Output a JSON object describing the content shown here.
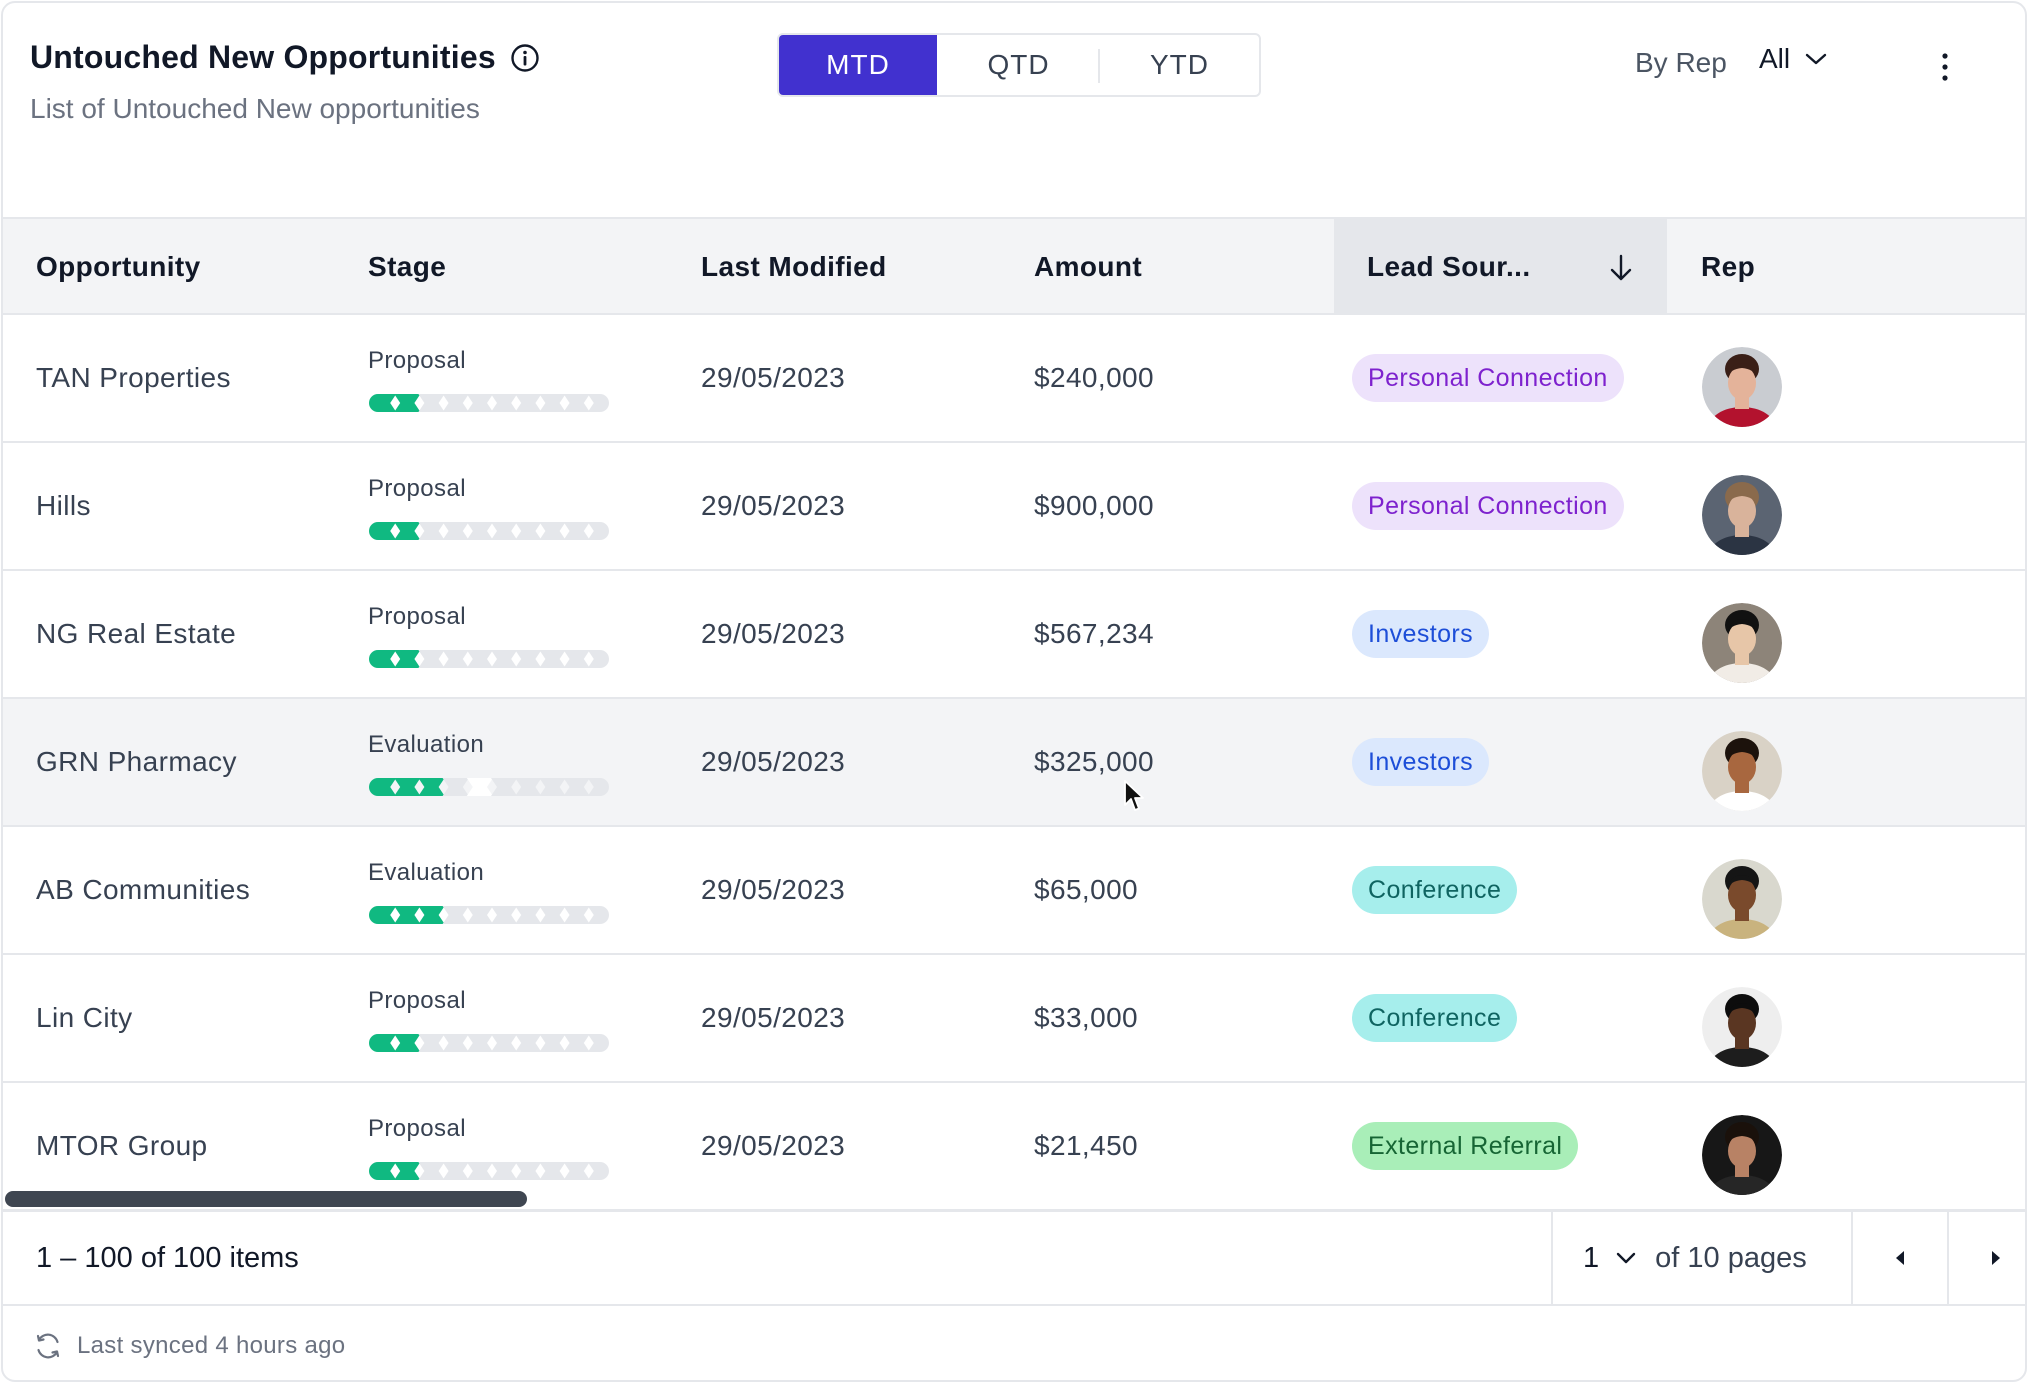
{
  "header": {
    "title": "Untouched New Opportunities",
    "subtitle": "List of Untouched New opportunities",
    "info_icon": "info-circle-icon"
  },
  "period_tabs": [
    {
      "label": "MTD",
      "active": true
    },
    {
      "label": "QTD",
      "active": false
    },
    {
      "label": "YTD",
      "active": false
    }
  ],
  "rep_filter": {
    "label": "By Rep",
    "value": "All",
    "icon": "chevron-down-icon"
  },
  "menu_icon": "kebab-menu-icon",
  "table": {
    "columns": [
      "Opportunity",
      "Stage",
      "Last Modified",
      "Amount",
      "Lead Sour...",
      "Rep"
    ],
    "sorted_column": "Lead Sour...",
    "sort_direction": "descending",
    "stage_segments_total": 10,
    "rows": [
      {
        "opportunity": "TAN Properties",
        "stage": "Proposal",
        "stage_progress": 2,
        "last_modified": "29/05/2023",
        "amount": "$240,000",
        "lead_source": "Personal Connection",
        "lead_color": "purple"
      },
      {
        "opportunity": "Hills",
        "stage": "Proposal",
        "stage_progress": 2,
        "last_modified": "29/05/2023",
        "amount": "$900,000",
        "lead_source": "Personal Connection",
        "lead_color": "purple"
      },
      {
        "opportunity": "NG Real Estate",
        "stage": "Proposal",
        "stage_progress": 2,
        "last_modified": "29/05/2023",
        "amount": "$567,234",
        "lead_source": "Investors",
        "lead_color": "blue"
      },
      {
        "opportunity": "GRN Pharmacy",
        "stage": "Evaluation",
        "stage_progress": 3,
        "last_modified": "29/05/2023",
        "amount": "$325,000",
        "lead_source": "Investors",
        "lead_color": "blue"
      },
      {
        "opportunity": "AB Communities",
        "stage": "Evaluation",
        "stage_progress": 3,
        "last_modified": "29/05/2023",
        "amount": "$65,000",
        "lead_source": "Conference",
        "lead_color": "teal"
      },
      {
        "opportunity": "Lin City",
        "stage": "Proposal",
        "stage_progress": 2,
        "last_modified": "29/05/2023",
        "amount": "$33,000",
        "lead_source": "Conference",
        "lead_color": "teal"
      },
      {
        "opportunity": "MTOR Group",
        "stage": "Proposal",
        "stage_progress": 2,
        "last_modified": "29/05/2023",
        "amount": "$21,450",
        "lead_source": "External Referral",
        "lead_color": "green"
      }
    ]
  },
  "badge_colors": {
    "purple": {
      "bg": "#ede2fb",
      "fg": "#7e22ce"
    },
    "blue": {
      "bg": "#dbe8fd",
      "fg": "#1d4ed8"
    },
    "teal": {
      "bg": "#a6eeec",
      "fg": "#0f6461"
    },
    "green": {
      "bg": "#a9eeb8",
      "fg": "#166534"
    }
  },
  "avatar_colors": [
    {
      "skin": "#e4b39a",
      "hair": "#3a1f17",
      "shirt": "#b3122e",
      "bg": "#c9ccd1"
    },
    {
      "skin": "#d9b39b",
      "hair": "#8a6a4c",
      "shirt": "#2b3443",
      "bg": "#5b6472"
    },
    {
      "skin": "#e7c6a8",
      "hair": "#111111",
      "shirt": "#f1ece6",
      "bg": "#8d8479"
    },
    {
      "skin": "#a8673f",
      "hair": "#1c120c",
      "shirt": "#ffffff",
      "bg": "#d9d2c6"
    },
    {
      "skin": "#7a4a2c",
      "hair": "#151515",
      "shirt": "#c9b37e",
      "bg": "#d9d8ce"
    },
    {
      "skin": "#5a3622",
      "hair": "#0d0d0d",
      "shirt": "#1d1d1d",
      "bg": "#eeeeee"
    },
    {
      "skin": "#b88265",
      "hair": "#1a110b",
      "shirt": "#262626",
      "bg": "#171717"
    }
  ],
  "progress_colors": {
    "filled": "#10b981",
    "empty": "#e5e7eb"
  },
  "pagination": {
    "items_text": "1 – 100 of 100 items",
    "page": "1",
    "of_text": "of 10 pages",
    "prev_icon": "caret-left-icon",
    "next_icon": "caret-right-icon"
  },
  "footer": {
    "sync_text": "Last synced 4 hours ago",
    "sync_icon": "refresh-icon"
  },
  "accent_color": "#4131cf"
}
